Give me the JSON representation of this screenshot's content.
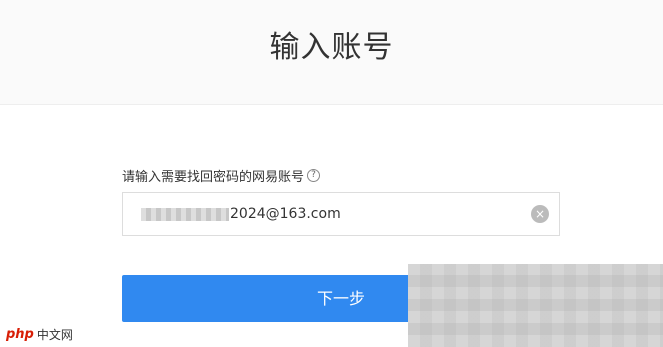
{
  "page": {
    "title": "输入账号"
  },
  "form": {
    "label": "请输入需要找回密码的网易账号",
    "help_icon_glyph": "?",
    "account_value": "2024@163.com",
    "clear_icon_glyph": "×"
  },
  "actions": {
    "next_label": "下一步"
  },
  "watermark": {
    "logo_text": "php",
    "site_text": "中文网"
  },
  "colors": {
    "primary": "#3089f0",
    "header_bg": "#fafafa"
  },
  "icons": {
    "help": "help-circle-icon",
    "clear": "clear-circle-icon"
  }
}
